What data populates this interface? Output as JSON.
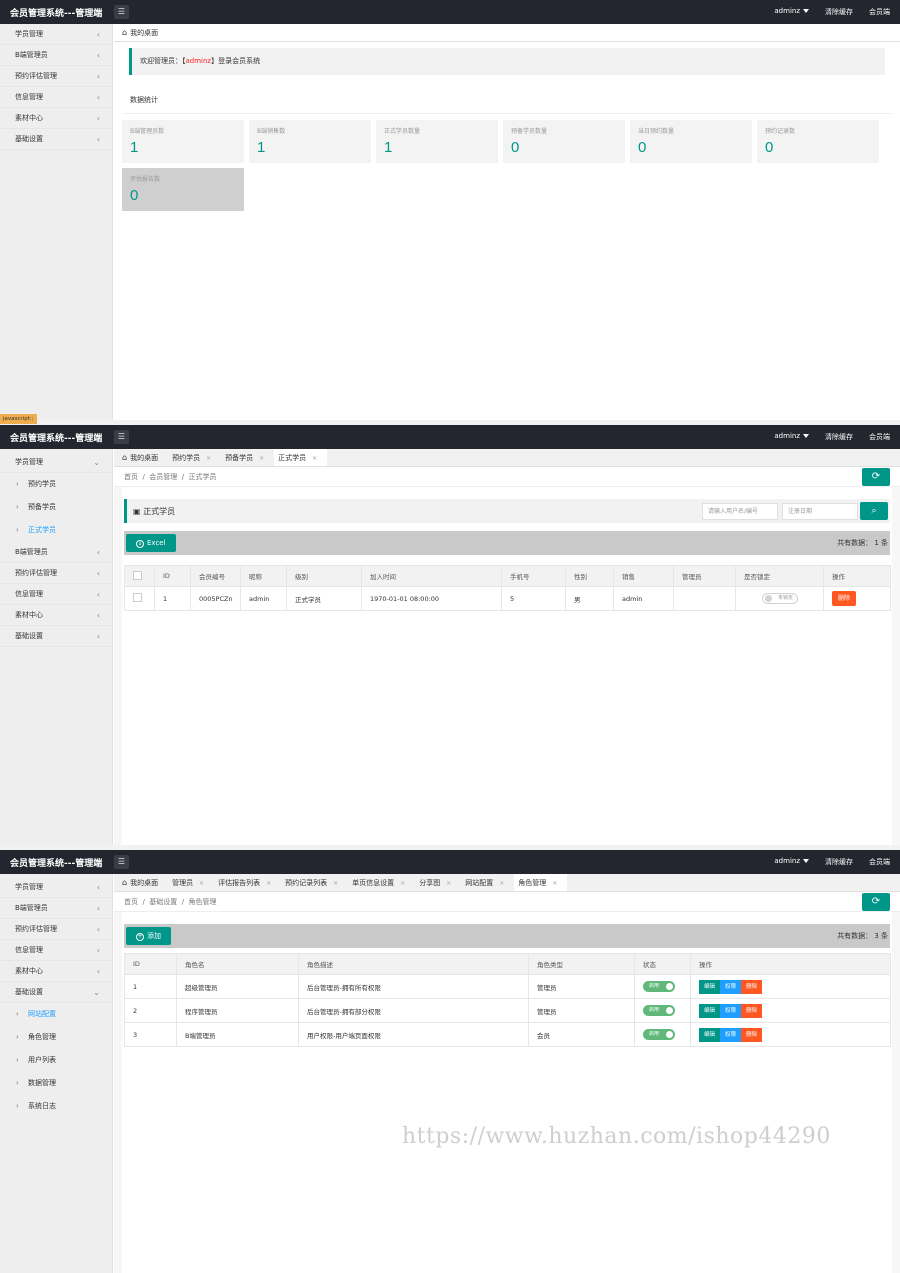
{
  "header": {
    "brand": "会员管理系统---管理端",
    "menu_icon": "list-icon",
    "user": "adminz",
    "clear_cache": "清除缓存",
    "member_side": "会员端"
  },
  "panel1": {
    "sidebar": [
      "学员管理",
      "B端管理员",
      "预约评估管理",
      "信息管理",
      "素材中心",
      "基础设置"
    ],
    "tab_home": "我的桌面",
    "welcome_prefix": "欢迎管理员：【",
    "welcome_user": "adminz",
    "welcome_suffix": "】登录会员系统",
    "stats_title": "数据统计",
    "stats": [
      {
        "label": "B端管理员数",
        "value": "1"
      },
      {
        "label": "B端销售数",
        "value": "1"
      },
      {
        "label": "正式学员数量",
        "value": "1"
      },
      {
        "label": "预备学员数量",
        "value": "0"
      },
      {
        "label": "当日预约数量",
        "value": "0"
      },
      {
        "label": "预约记录数",
        "value": "0"
      },
      {
        "label": "评估报告数",
        "value": "0"
      }
    ]
  },
  "js_badge": "javascript:;",
  "panel2": {
    "sidebar_group": "学员管理",
    "sidebar_subs": [
      "预约学员",
      "预备学员",
      "正式学员"
    ],
    "sidebar_rest": [
      "B端管理员",
      "预约评估管理",
      "信息管理",
      "素材中心",
      "基础设置"
    ],
    "tabs": [
      "我的桌面",
      "预约学员",
      "预备学员",
      "正式学员"
    ],
    "breadcrumb": [
      "首页",
      "会员管理",
      "正式学员"
    ],
    "section_title": "正式学员",
    "search_placeholder": "请输入用户名/编号",
    "date_placeholder": "注册日期",
    "excel_label": "Excel",
    "count_text": "共有数据： 1 条",
    "columns": [
      "",
      "ID",
      "会员编号",
      "昵称",
      "级别",
      "加入时间",
      "手机号",
      "性别",
      "销售",
      "管理员",
      "是否锁定",
      "操作"
    ],
    "rows": [
      {
        "id": "1",
        "code": "0005PCZn",
        "nickname": "admin",
        "level": "正式学员",
        "joined": "1970-01-01 08:00:00",
        "phone": "5",
        "gender": "男",
        "sales": "admin",
        "admin": "",
        "lock": "未锁定",
        "delete": "删除"
      }
    ]
  },
  "panel3": {
    "sidebar_top": [
      "学员管理",
      "B端管理员",
      "预约评估管理",
      "信息管理",
      "素材中心"
    ],
    "sidebar_group": "基础设置",
    "sidebar_subs": [
      "网站配置",
      "角色管理",
      "用户列表",
      "数据管理",
      "系统日志"
    ],
    "tabs": [
      "我的桌面",
      "管理员",
      "评估报告列表",
      "预约记录列表",
      "单页信息设置",
      "分享图",
      "网站配置",
      "角色管理"
    ],
    "breadcrumb": [
      "首页",
      "基础设置",
      "角色管理"
    ],
    "add_label": "添加",
    "count_text": "共有数据： 3 条",
    "columns": [
      "ID",
      "角色名",
      "角色描述",
      "角色类型",
      "状态",
      "操作"
    ],
    "rows": [
      {
        "id": "1",
        "name": "超级管理员",
        "desc": "后台管理员-拥有所有权限",
        "type": "管理员",
        "status": "启用"
      },
      {
        "id": "2",
        "name": "程序管理员",
        "desc": "后台管理员-拥有部分权限",
        "type": "管理员",
        "status": "启用"
      },
      {
        "id": "3",
        "name": "B端管理员",
        "desc": "用户权限-用户端页面权限",
        "type": "会员",
        "status": "启用"
      }
    ],
    "btn_edit": "编辑",
    "btn_perm": "权限",
    "btn_del": "删除"
  },
  "watermark": "https://www.huzhan.com/ishop44290"
}
